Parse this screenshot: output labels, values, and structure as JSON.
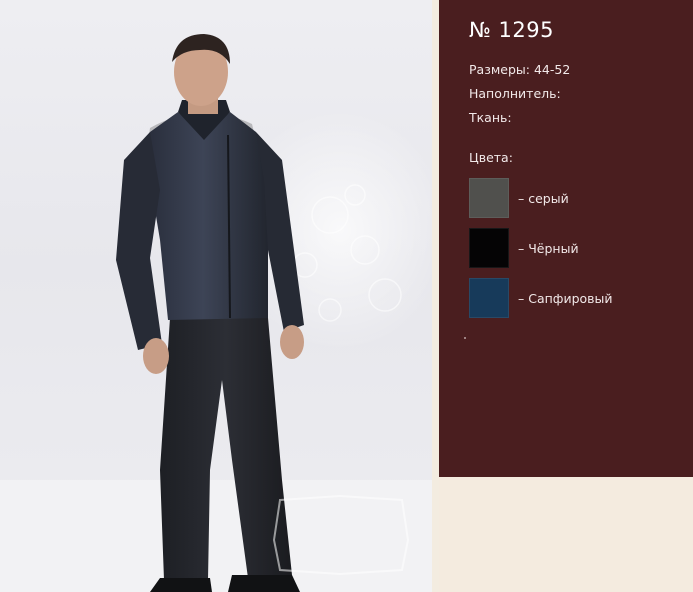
{
  "product": {
    "model_number": "№ 1295",
    "sizes": "Размеры: 44-52",
    "filler": "Наполнитель:",
    "fabric": "Ткань:",
    "colors_title": "Цвета:"
  },
  "colors": [
    {
      "label": "– серый",
      "hex": "#50504d"
    },
    {
      "label": "– Чёрный",
      "hex": "#050405"
    },
    {
      "label": "– Сапфировый",
      "hex": "#173a5a"
    }
  ],
  "photo": {
    "watermark": "LIYANA",
    "subject": "man-in-quilted-jacket-photo"
  },
  "theme": {
    "panel_color": "#4a1e1f",
    "page_background": "#f3ece0"
  }
}
